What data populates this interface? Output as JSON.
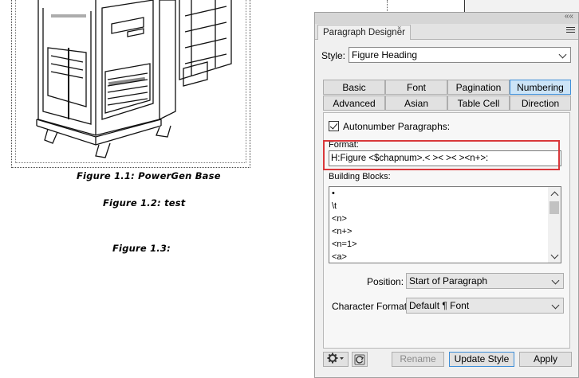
{
  "document": {
    "captions": [
      "Figure 1.1: PowerGen Base",
      "Figure 1.2: test",
      "Figure 1.3:"
    ]
  },
  "panel": {
    "title": "Paragraph Designer",
    "collapse_glyph": "««",
    "close_glyph": "×",
    "style_label": "Style:",
    "style_value": "Figure Heading",
    "tabs_row1": [
      "Basic",
      "Font",
      "Pagination",
      "Numbering"
    ],
    "tabs_row2": [
      "Advanced",
      "Asian",
      "Table Cell",
      "Direction"
    ],
    "active_tab": "Numbering",
    "autonumber_label": "Autonumber Paragraphs:",
    "autonumber_checked": true,
    "format_label": "Format:",
    "format_value": "H:Figure <$chapnum>.< >< >< ><n+>:",
    "building_blocks_label": "Building Blocks:",
    "building_blocks": [
      "•",
      "\\t",
      "<n>",
      "<n+>",
      "<n=1>",
      "<a>"
    ],
    "position_label": "Position:",
    "position_value": "Start of Paragraph",
    "char_format_label": "Character Format:",
    "char_format_value": "Default ¶ Font",
    "buttons": {
      "rename": "Rename",
      "update_style": "Update Style",
      "apply": "Apply"
    }
  },
  "colors": {
    "highlight": "#d9383b",
    "active_tab": "#cce4f7",
    "accent": "#3d8ed8"
  },
  "icons": [
    "gear-icon",
    "refresh-icon",
    "menu-icon",
    "chevron-down-icon",
    "checkbox-icon"
  ]
}
